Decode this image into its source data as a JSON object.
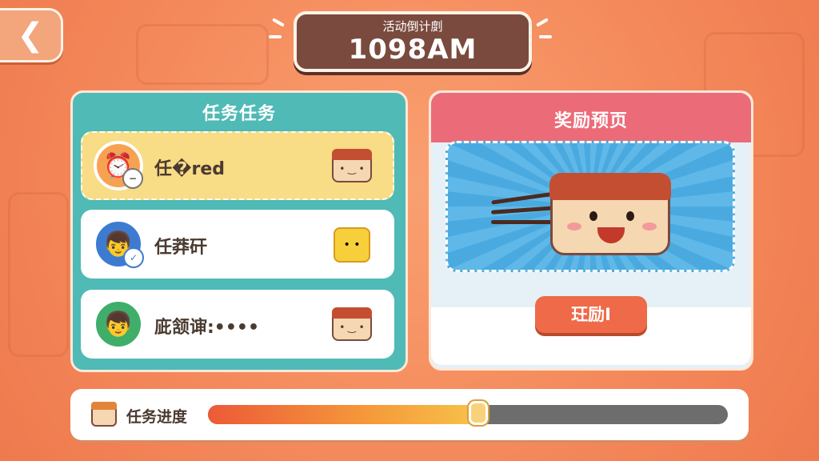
{
  "header": {
    "back_icon": "chevron-left-icon",
    "countdown_label": "活动倒计剫",
    "countdown_value": "1098AM"
  },
  "tasks": {
    "title": "任务任务",
    "items": [
      {
        "name": "任�red",
        "avatar": "clock-icon",
        "reward": "food-item-icon"
      },
      {
        "name": "任莽矸",
        "avatar": "boy-avatar",
        "reward": "gift-box-icon"
      },
      {
        "name": "庛颔谉:••••",
        "avatar": "boy-avatar",
        "reward": "food-item-icon"
      }
    ]
  },
  "reward": {
    "title": "奖励预页",
    "preview_icon": "food-character-icon",
    "claim_label": "玨励I"
  },
  "progress": {
    "label": "任务进度",
    "value": 0.52
  },
  "colors": {
    "background": "#f4885a",
    "task_panel": "#4fbab6",
    "reward_header": "#ec6b78",
    "claim_button": "#ee6a48",
    "countdown_bg": "#7a4a3e"
  }
}
